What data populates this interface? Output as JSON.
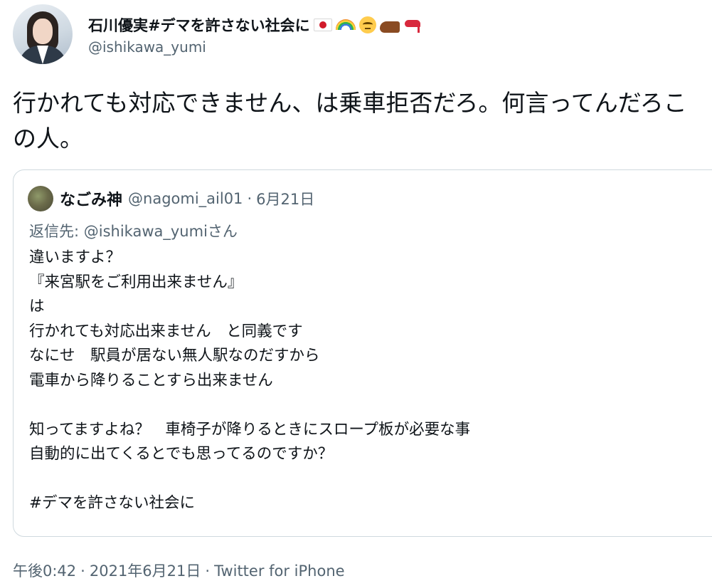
{
  "author": {
    "display_name": "石川優実#デマを許さない社会に",
    "emoji": [
      "japan-flag-emoji",
      "rainbow-emoji",
      "eye-roll-emoji",
      "mans-shoe-emoji",
      "high-heel-emoji"
    ],
    "username": "@ishikawa_yumi"
  },
  "tweet": {
    "text": "行かれても対応できません、は乗車拒否だろ。何言ってんだろこの人。"
  },
  "quoted_tweet": {
    "display_name": "なごみ神",
    "username": "@nagomi_ail01",
    "separator": "·",
    "date": "6月21日",
    "reply_to": "返信先: @ishikawa_yumiさん",
    "lines": [
      "違いますよ？",
      "『来宮駅をご利用出来ません』",
      "は",
      "行かれても対応出来ません　と同義です",
      "なにせ　駅員が居ない無人駅なのだすから",
      "電車から降りることすら出来ません",
      "",
      "知ってますよね？　車椅子が降りるときにスロープ板が必要な事",
      "自動的に出てくるとでも思ってるのですか？",
      "",
      "#デマを許さない社会に"
    ]
  },
  "footer": {
    "time": "午後0:42",
    "date": "2021年6月21日",
    "source": "Twitter for iPhone",
    "separator": "·"
  },
  "colors": {
    "text": "#0f1419",
    "secondary": "#536471",
    "border": "#cfd9de"
  }
}
